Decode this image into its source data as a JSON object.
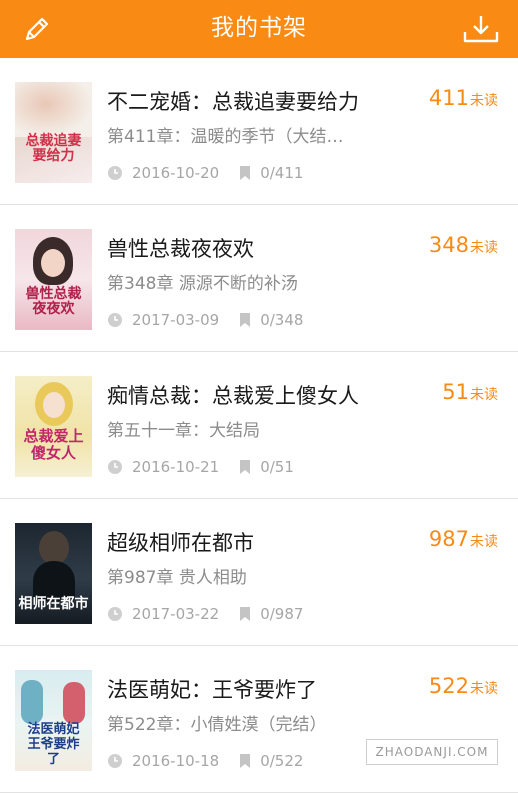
{
  "header": {
    "title": "我的书架",
    "left_icon": "pencil-edit-icon",
    "right_icon": "download-icon",
    "color": "#f98a14"
  },
  "books": [
    {
      "title": "不二宠婚：总裁追妻要给力",
      "latest_chapter": "第411章：温暖的季节（大结…",
      "date": "2016-10-20",
      "progress": "0/411",
      "unread_count": "411",
      "unread_label": "未读",
      "cover_text": "总裁追妻要给力"
    },
    {
      "title": "兽性总裁夜夜欢",
      "latest_chapter": "第348章 源源不断的补汤",
      "date": "2017-03-09",
      "progress": "0/348",
      "unread_count": "348",
      "unread_label": "未读",
      "cover_text": "兽性总裁夜夜欢"
    },
    {
      "title": "痴情总裁：总裁爱上傻女人",
      "latest_chapter": "第五十一章：大结局",
      "date": "2016-10-21",
      "progress": "0/51",
      "unread_count": "51",
      "unread_label": "未读",
      "cover_text": "总裁爱上傻女人"
    },
    {
      "title": "超级相师在都市",
      "latest_chapter": "第987章 贵人相助",
      "date": "2017-03-22",
      "progress": "0/987",
      "unread_count": "987",
      "unread_label": "未读",
      "cover_text": "相师在都市"
    },
    {
      "title": "法医萌妃：王爷要炸了",
      "latest_chapter": "第522章：小倩姓漠（完结）",
      "date": "2016-10-18",
      "progress": "0/522",
      "unread_count": "522",
      "unread_label": "未读",
      "cover_text": "法医萌妃王爷要炸了"
    }
  ],
  "watermark": "ZHAODANJI.COM",
  "colors": {
    "accent": "#f98a14",
    "secondary_text": "#8c8c8c"
  }
}
